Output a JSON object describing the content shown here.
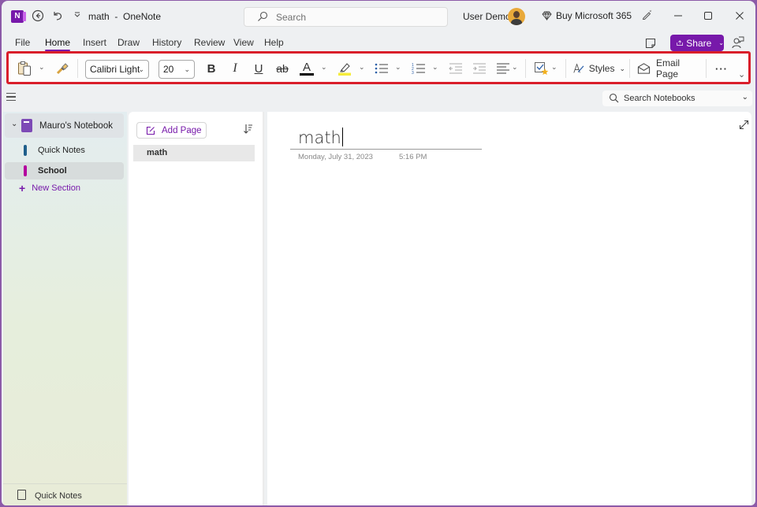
{
  "titlebar": {
    "app_icon_letter": "N",
    "document_title": "math  -  OneNote",
    "search_placeholder": "Search",
    "user_name": "User Demo",
    "buy_label": "Buy Microsoft 365"
  },
  "menu": {
    "tabs": [
      {
        "label": "File",
        "active": false
      },
      {
        "label": "Home",
        "active": true
      },
      {
        "label": "Insert",
        "active": false
      },
      {
        "label": "Draw",
        "active": false
      },
      {
        "label": "History",
        "active": false
      },
      {
        "label": "Review",
        "active": false
      },
      {
        "label": "View",
        "active": false
      },
      {
        "label": "Help",
        "active": false
      }
    ],
    "share_label": "Share"
  },
  "ribbon": {
    "font_name": "Calibri Light",
    "font_size": "20",
    "bold": "B",
    "italic": "I",
    "underline": "U",
    "strikethrough": "ab",
    "font_color_glyph": "A",
    "font_color": "#000000",
    "highlight_color": "#f5ec3a",
    "styles_label": "Styles",
    "email_page_label": "Email Page",
    "more_glyph": "···"
  },
  "subbar": {
    "search_notebooks_placeholder": "Search Notebooks"
  },
  "sidebar": {
    "notebook_name": "Mauro's Notebook",
    "notebook_color": "#7d4ab6",
    "sections": [
      {
        "label": "Quick Notes",
        "color": "#1f5f8b",
        "selected": false
      },
      {
        "label": "School",
        "color": "#b4009e",
        "selected": true
      }
    ],
    "new_section_label": "New Section",
    "footer_label": "Quick Notes"
  },
  "pages": {
    "add_page_label": "Add Page",
    "items": [
      {
        "label": "math",
        "selected": true
      }
    ]
  },
  "page": {
    "title": "math",
    "date": "Monday, July 31, 2023",
    "time": "5:16 PM"
  },
  "colors": {
    "accent": "#7719aa",
    "ribbon_highlight_border": "#d91e2a"
  }
}
